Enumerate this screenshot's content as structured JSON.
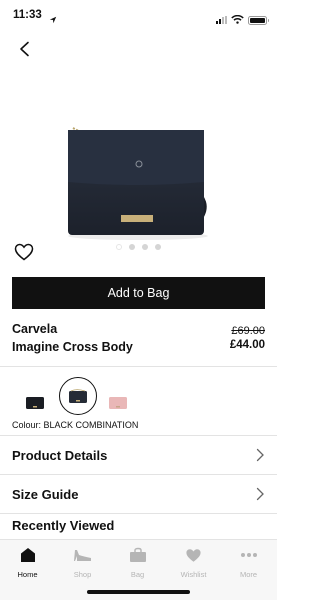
{
  "status_bar": {
    "time": "11:33"
  },
  "product": {
    "brand": "Carvela",
    "name": "Imagine Cross Body",
    "price_was": "£69.00",
    "price_now": "£44.00",
    "gallery_images": 4,
    "gallery_current": 1,
    "add_to_bag_label": "Add to Bag",
    "colour_text": "Colour: BLACK COMBINATION",
    "swatches": [
      "black",
      "navy-black",
      "pink"
    ]
  },
  "sections": {
    "details": "Product Details",
    "size_guide": "Size Guide",
    "recently_viewed": "Recently Viewed"
  },
  "tabbar": {
    "home": "Home",
    "shop": "Shop",
    "bag": "Bag",
    "wishlist": "Wishlist",
    "more": "More"
  },
  "icons": {
    "back": "chevron-left-icon",
    "favourite": "heart-outline-icon",
    "chevron": "chevron-right-icon"
  },
  "colors": {
    "primary": "#111111",
    "inactive": "#b5b5b5",
    "bag_body": "#242a35",
    "swatch_pink": "#e9b7b7"
  }
}
